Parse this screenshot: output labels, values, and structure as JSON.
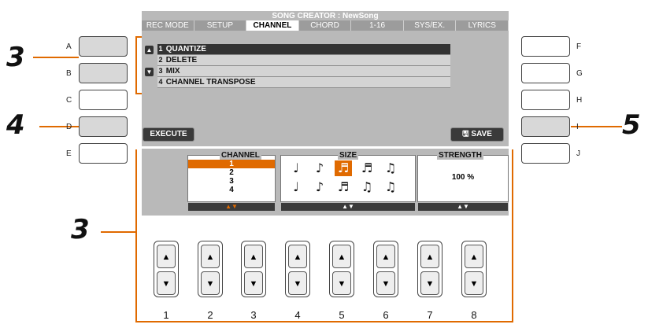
{
  "screen": {
    "title": "SONG CREATOR : NewSong",
    "tabs": [
      "REC MODE",
      "SETUP",
      "CHANNEL",
      "CHORD",
      "1-16",
      "SYS/EX.",
      "LYRICS"
    ],
    "active_tab": "CHANNEL",
    "menu": [
      {
        "num": "1",
        "label": "QUANTIZE"
      },
      {
        "num": "2",
        "label": "DELETE"
      },
      {
        "num": "3",
        "label": "MIX"
      },
      {
        "num": "4",
        "label": "CHANNEL TRANSPOSE"
      }
    ],
    "execute_label": "EXECUTE",
    "save_label": "SAVE"
  },
  "panel": {
    "channel": {
      "title": "CHANNEL",
      "values": [
        "1",
        "2",
        "3",
        "4"
      ],
      "selected": "1"
    },
    "size": {
      "title": "SIZE",
      "selected_index": 2
    },
    "strength": {
      "title": "STRENGTH",
      "value": "100 %"
    }
  },
  "side_left": [
    "A",
    "B",
    "C",
    "D",
    "E"
  ],
  "side_right": [
    "F",
    "G",
    "H",
    "I",
    "J"
  ],
  "steps": [
    "3",
    "4",
    "3",
    "5"
  ],
  "hardware_buttons": [
    "1",
    "2",
    "3",
    "4",
    "5",
    "6",
    "7",
    "8"
  ],
  "colors": {
    "accent": "#e06a00",
    "screen_bg": "#b9b9b9",
    "dark": "#333333"
  }
}
